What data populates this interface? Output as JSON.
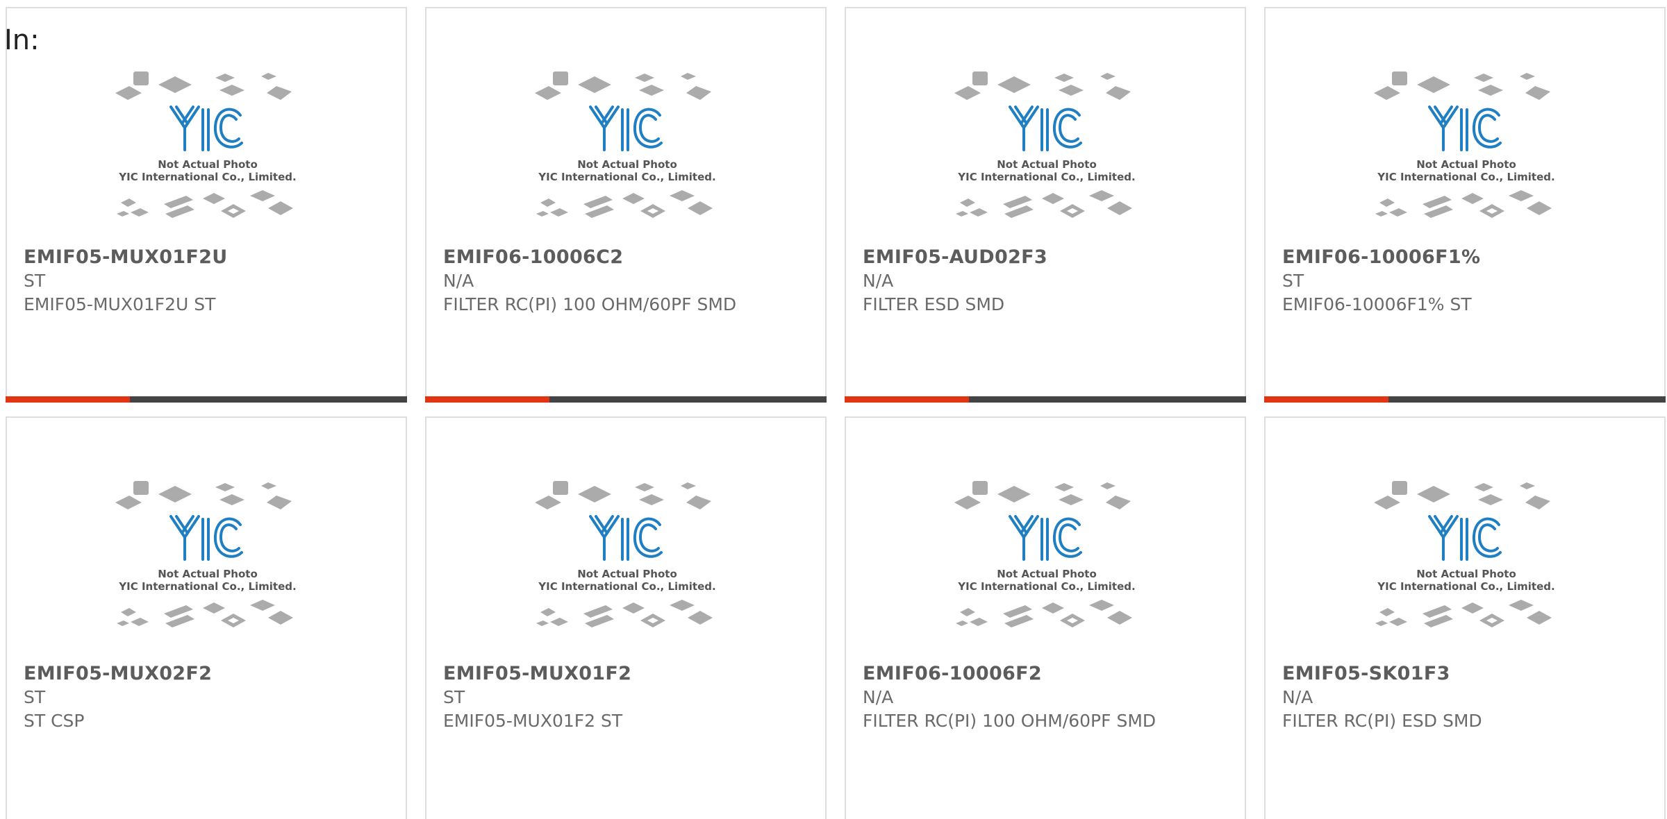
{
  "page": {
    "label": "In:"
  },
  "watermark": {
    "line1": "Not Actual Photo",
    "line2": "YIC International Co., Limited.",
    "logo_text": "YIC",
    "logo_color": "#1f7fc2",
    "chip_color": "#ababab"
  },
  "colors": {
    "accent": "#e03412",
    "bar_track": "#444444",
    "card_border": "#dedede",
    "text": "#6a6a6a"
  },
  "products": [
    {
      "part_no": "EMIF05-MUX01F2U",
      "manufacturer": "ST",
      "description": "EMIF05-MUX01F2U ST",
      "progress": 0.31
    },
    {
      "part_no": "EMIF06-10006C2",
      "manufacturer": "N/A",
      "description": "FILTER RC(PI) 100 OHM/60PF SMD",
      "progress": 0.31
    },
    {
      "part_no": "EMIF05-AUD02F3",
      "manufacturer": "N/A",
      "description": "FILTER ESD SMD",
      "progress": 0.31
    },
    {
      "part_no": "EMIF06-10006F1%",
      "manufacturer": "ST",
      "description": "EMIF06-10006F1% ST",
      "progress": 0.31
    },
    {
      "part_no": "EMIF05-MUX02F2",
      "manufacturer": "ST",
      "description": "ST CSP",
      "progress": 0
    },
    {
      "part_no": "EMIF05-MUX01F2",
      "manufacturer": "ST",
      "description": "EMIF05-MUX01F2 ST",
      "progress": 0
    },
    {
      "part_no": "EMIF06-10006F2",
      "manufacturer": "N/A",
      "description": "FILTER RC(PI) 100 OHM/60PF SMD",
      "progress": 0
    },
    {
      "part_no": "EMIF05-SK01F3",
      "manufacturer": "N/A",
      "description": "FILTER RC(PI) ESD SMD",
      "progress": 0
    }
  ]
}
